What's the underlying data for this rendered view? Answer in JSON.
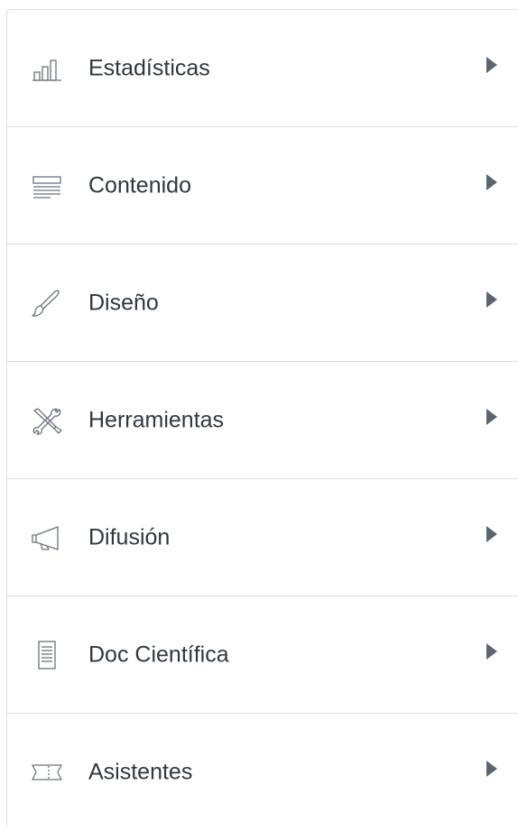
{
  "menu": {
    "items": [
      {
        "label": "Estadísticas",
        "icon": "bar-chart-icon"
      },
      {
        "label": "Contenido",
        "icon": "content-icon"
      },
      {
        "label": "Diseño",
        "icon": "brush-icon"
      },
      {
        "label": "Herramientas",
        "icon": "tools-icon"
      },
      {
        "label": "Difusión",
        "icon": "megaphone-icon"
      },
      {
        "label": "Doc Científica",
        "icon": "document-icon"
      },
      {
        "label": "Asistentes",
        "icon": "ticket-icon"
      }
    ]
  },
  "colors": {
    "text": "#2f3742",
    "icon": "#6b7480",
    "arrow": "#5b6572",
    "divider": "#d9dde3"
  }
}
